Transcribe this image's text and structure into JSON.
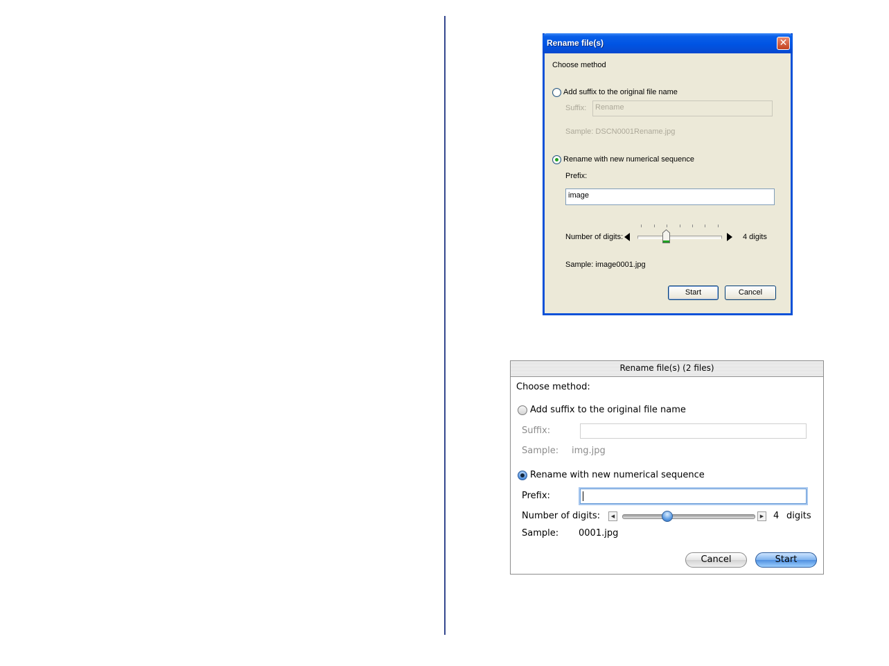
{
  "xp_dialog": {
    "title": "Rename file(s)",
    "close_symbol": "✕",
    "choose_method": "Choose method",
    "option_suffix": "Add suffix to the original file name",
    "suffix_label": "Suffix:",
    "suffix_value": "Rename",
    "suffix_sample": "Sample: DSCN0001Rename.jpg",
    "option_sequence": "Rename with new numerical sequence",
    "prefix_label": "Prefix:",
    "prefix_value": "image",
    "digits_label": "Number of digits:",
    "digits_value": "4 digits",
    "sequence_sample": "Sample: image0001.jpg",
    "start_button": "Start",
    "cancel_button": "Cancel",
    "selected_option": "sequence",
    "digits_slider_level": 4,
    "accent_color": "#0054e3"
  },
  "mac_dialog": {
    "title": "Rename file(s) (2 files)",
    "choose_method": "Choose method:",
    "option_suffix": "Add suffix to the original file name",
    "suffix_label": "Suffix:",
    "suffix_value": "",
    "suffix_sample_label": "Sample:",
    "suffix_sample_value": "img.jpg",
    "option_sequence": "Rename with new numerical sequence",
    "prefix_label": "Prefix:",
    "prefix_value": "",
    "digits_label": "Number of digits:",
    "digits_number": "4",
    "digits_unit": "digits",
    "sequence_sample_label": "Sample:",
    "sequence_sample_value": "0001.jpg",
    "cancel_button": "Cancel",
    "start_button": "Start",
    "selected_option": "sequence",
    "digits_slider_level": 4,
    "accent_color": "#4f8fe0"
  }
}
